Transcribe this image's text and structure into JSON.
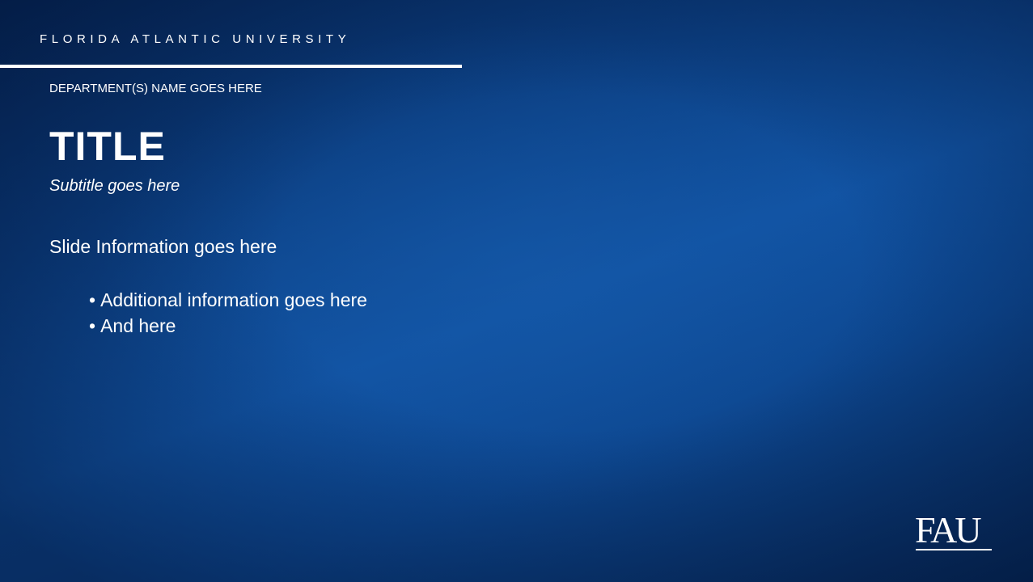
{
  "header": {
    "university_name": "FLORIDA ATLANTIC UNIVERSITY"
  },
  "slide": {
    "department": "DEPARTMENT(S) NAME GOES HERE",
    "title": "TITLE",
    "subtitle": "Subtitle goes here",
    "body": "Slide Information goes here",
    "bullets": [
      "Additional information goes here",
      "And here"
    ]
  },
  "logo": {
    "text": "FAU",
    "icon": "fau-wave-logo"
  },
  "colors": {
    "background_dark": "#06285a",
    "background_light": "#1153a3",
    "text": "#ffffff"
  }
}
